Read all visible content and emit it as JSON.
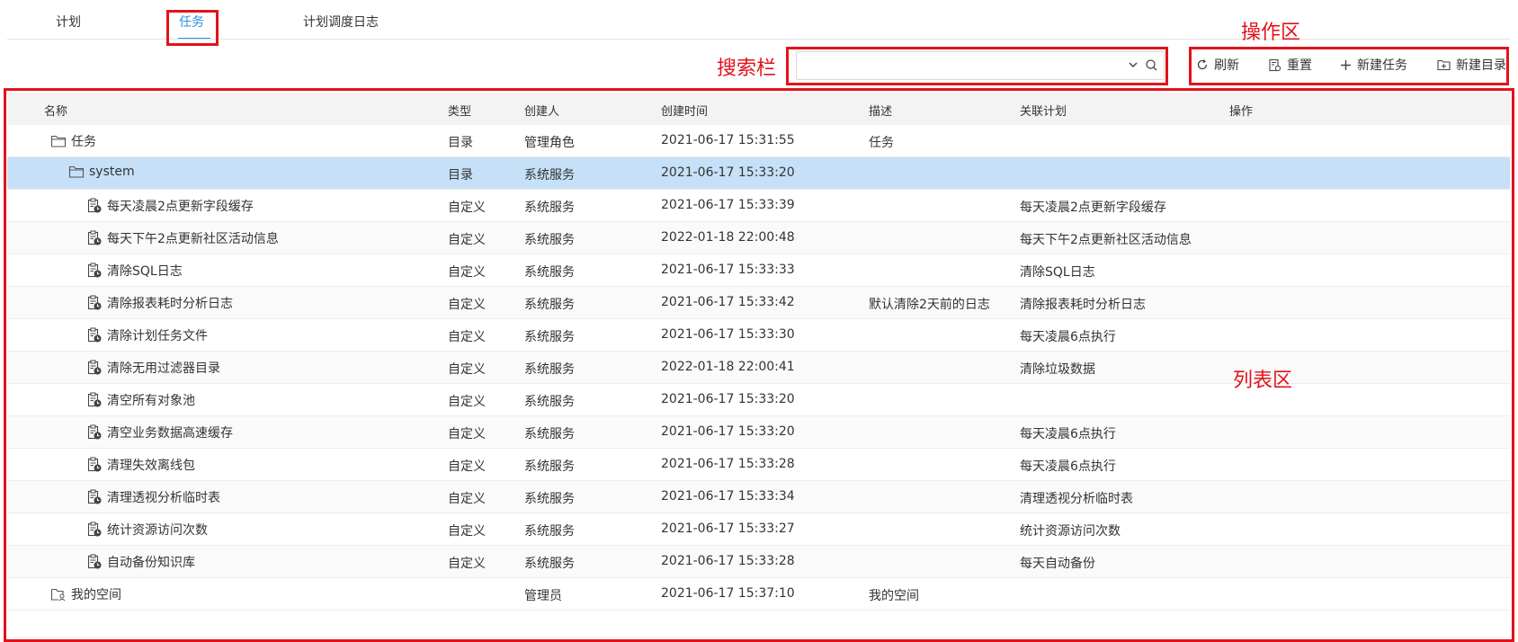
{
  "tabs": [
    {
      "label": "计划",
      "active": false
    },
    {
      "label": "任务",
      "active": true
    },
    {
      "label": "计划调度日志",
      "active": false
    }
  ],
  "search": {
    "placeholder": "",
    "value": ""
  },
  "toolbar": {
    "refresh": "刷新",
    "reset": "重置",
    "new_task": "新建任务",
    "new_dir": "新建目录"
  },
  "annotations": {
    "search": "搜索栏",
    "actions": "操作区",
    "list": "列表区"
  },
  "table": {
    "headers": {
      "name": "名称",
      "type": "类型",
      "creator": "创建人",
      "created": "创建时间",
      "desc": "描述",
      "plan": "关联计划",
      "op": "操作"
    },
    "rows": [
      {
        "name": "任务",
        "icon": "folder-icon",
        "level": 0,
        "type": "目录",
        "creator": "管理角色",
        "created": "2021-06-17 15:31:55",
        "desc": "任务",
        "plan": ""
      },
      {
        "name": "system",
        "icon": "folder-icon",
        "level": 1,
        "type": "目录",
        "creator": "系统服务",
        "created": "2021-06-17 15:33:20",
        "desc": "",
        "plan": "",
        "selected": true
      },
      {
        "name": "每天凌晨2点更新字段缓存",
        "icon": "task-icon",
        "level": 2,
        "type": "自定义",
        "creator": "系统服务",
        "created": "2021-06-17 15:33:39",
        "desc": "",
        "plan": "每天凌晨2点更新字段缓存"
      },
      {
        "name": "每天下午2点更新社区活动信息",
        "icon": "task-icon",
        "level": 2,
        "type": "自定义",
        "creator": "系统服务",
        "created": "2022-01-18 22:00:48",
        "desc": "",
        "plan": "每天下午2点更新社区活动信息"
      },
      {
        "name": "清除SQL日志",
        "icon": "task-icon",
        "level": 2,
        "type": "自定义",
        "creator": "系统服务",
        "created": "2021-06-17 15:33:33",
        "desc": "",
        "plan": "清除SQL日志"
      },
      {
        "name": "清除报表耗时分析日志",
        "icon": "task-icon",
        "level": 2,
        "type": "自定义",
        "creator": "系统服务",
        "created": "2021-06-17 15:33:42",
        "desc": "默认清除2天前的日志",
        "plan": "清除报表耗时分析日志"
      },
      {
        "name": "清除计划任务文件",
        "icon": "task-icon",
        "level": 2,
        "type": "自定义",
        "creator": "系统服务",
        "created": "2021-06-17 15:33:30",
        "desc": "",
        "plan": "每天凌晨6点执行"
      },
      {
        "name": "清除无用过滤器目录",
        "icon": "task-icon",
        "level": 2,
        "type": "自定义",
        "creator": "系统服务",
        "created": "2022-01-18 22:00:41",
        "desc": "",
        "plan": "清除垃圾数据"
      },
      {
        "name": "清空所有对象池",
        "icon": "task-icon",
        "level": 2,
        "type": "自定义",
        "creator": "系统服务",
        "created": "2021-06-17 15:33:20",
        "desc": "",
        "plan": ""
      },
      {
        "name": "清空业务数据高速缓存",
        "icon": "task-icon",
        "level": 2,
        "type": "自定义",
        "creator": "系统服务",
        "created": "2021-06-17 15:33:20",
        "desc": "",
        "plan": "每天凌晨6点执行"
      },
      {
        "name": "清理失效离线包",
        "icon": "task-icon",
        "level": 2,
        "type": "自定义",
        "creator": "系统服务",
        "created": "2021-06-17 15:33:28",
        "desc": "",
        "plan": "每天凌晨6点执行"
      },
      {
        "name": "清理透视分析临时表",
        "icon": "task-icon",
        "level": 2,
        "type": "自定义",
        "creator": "系统服务",
        "created": "2021-06-17 15:33:34",
        "desc": "",
        "plan": "清理透视分析临时表"
      },
      {
        "name": "统计资源访问次数",
        "icon": "task-icon",
        "level": 2,
        "type": "自定义",
        "creator": "系统服务",
        "created": "2021-06-17 15:33:27",
        "desc": "",
        "plan": "统计资源访问次数"
      },
      {
        "name": "自动备份知识库",
        "icon": "task-icon",
        "level": 2,
        "type": "自定义",
        "creator": "系统服务",
        "created": "2021-06-17 15:33:28",
        "desc": "",
        "plan": "每天自动备份"
      },
      {
        "name": "我的空间",
        "icon": "my-space-icon",
        "level": 0,
        "type": "",
        "creator": "管理员",
        "created": "2021-06-17 15:37:10",
        "desc": "我的空间",
        "plan": ""
      }
    ]
  },
  "colors": {
    "accent": "#2f8fde",
    "annotation": "#e3121a",
    "selected_row": "#c6e0f8"
  }
}
